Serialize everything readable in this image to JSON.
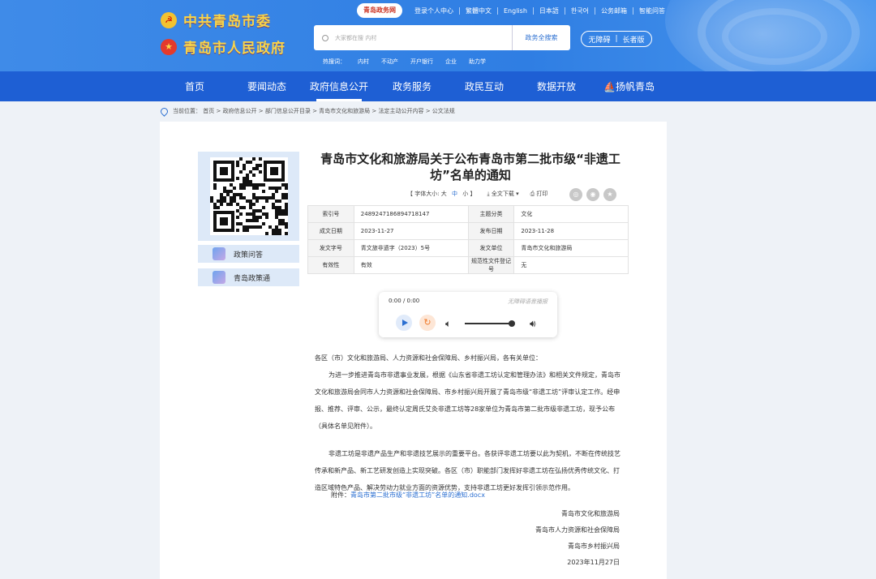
{
  "header": {
    "brand1": "中共青岛市委",
    "brand2": "青岛市人民政府",
    "logo_text": "青岛政务网",
    "top_links": [
      "登录个人中心",
      "繁體中文",
      "English",
      "日本語",
      "한국어",
      "公务邮箱",
      "智能问答"
    ],
    "search_placeholder": "大家都在搜 内村",
    "search_button": "政务全搜索",
    "hot_label": "热搜词：",
    "hot_words": [
      "内村",
      "不动产",
      "开户银行",
      "企业",
      "助力学"
    ],
    "access_a": "无障碍",
    "access_b": "长者版"
  },
  "nav": [
    "首页",
    "要闻动态",
    "政府信息公开",
    "政务服务",
    "政民互动",
    "数据开放",
    "扬帆青岛"
  ],
  "breadcrumb": "当前位置： 首页 > 政府信息公开 > 部门信息公开目录 > 青岛市文化和旅游局 > 法定主动公开内容 > 公文法规",
  "sidebar": {
    "items": [
      "政策问答",
      "青岛政策通"
    ]
  },
  "article": {
    "title": "青岛市文化和旅游局关于公布青岛市第二批市级“非遗工坊”名单的通知",
    "font_size_label": "【 字体大小: 大",
    "font_mid": "中",
    "font_small": "小 】",
    "download": "全文下载 ▾",
    "print": "打印"
  },
  "meta": [
    [
      "索引号",
      "2489247186894718147",
      "主题分类",
      "文化"
    ],
    [
      "成文日期",
      "2023-11-27",
      "发布日期",
      "2023-11-28"
    ],
    [
      "发文字号",
      "青文旅非遗字（2023）5号",
      "发文单位",
      "青岛市文化和旅游局"
    ],
    [
      "有效性",
      "有效",
      "规范性文件登记号",
      "无"
    ]
  ],
  "audio": {
    "time": "0:00 / 0:00",
    "brand": "无障碍语音播报"
  },
  "body": {
    "salutation": "各区（市）文化和旅游局、人力资源和社会保障局、乡村振兴局，各有关单位：",
    "p1": "为进一步推进青岛市非遗事业发展，根据《山东省非遗工坊认定和管理办法》和相关文件规定，青岛市文化和旅游局会同市人力资源和社会保障局、市乡村振兴局开展了青岛市级“非遗工坊”评审认定工作。经申报、推荐、评审、公示，最终认定周氏艾灸非遗工坊等28家单位为青岛市第二批市级非遗工坊，现予公布（具体名单见附件）。",
    "p2": "非遗工坊是非遗产品生产和非遗技艺展示的重要平台。各获评非遗工坊要以此为契机，不断在传统技艺传承和新产品、新工艺研发创造上实现突破。各区（市）职能部门发挥好非遗工坊在弘扬优秀传统文化、打造区域特色产品、解决劳动力就业方面的资源优势，支持非遗工坊更好发挥引领示范作用。",
    "attach_label": "附件：",
    "attach_link": "青岛市第二批市级“非遗工坊”名单的通知.docx",
    "sign1": "青岛市文化和旅游局",
    "sign2": "青岛市人力资源和社会保障局",
    "sign3": "青岛市乡村振兴局",
    "date": "2023年11月27日"
  }
}
